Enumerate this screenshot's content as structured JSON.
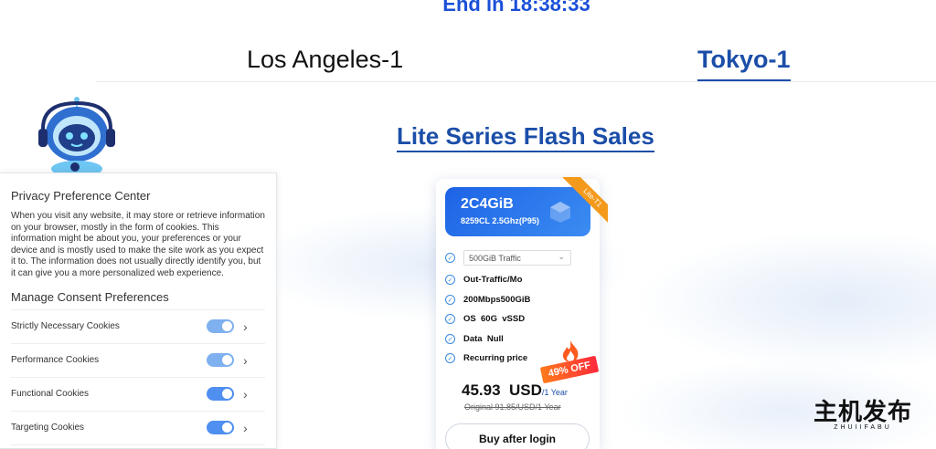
{
  "countdown": {
    "text": "End in 18:38:33"
  },
  "tabs": [
    {
      "label": "Los Angeles-1",
      "active": false
    },
    {
      "label": "Tokyo-1",
      "active": true
    }
  ],
  "section": {
    "title": "Lite Series Flash Sales"
  },
  "privacy": {
    "title": "Privacy Preference Center",
    "body": "When you visit any website, it may store or retrieve information on your browser, mostly in the form of cookies. This information might be about you, your preferences or your device and is mostly used to make the site work as you expect it to. The information does not usually directly identify you, but it can give you a more personalized web experience.",
    "manage_title": "Manage Consent Preferences",
    "items": [
      {
        "label": "Strictly Necessary Cookies"
      },
      {
        "label": "Performance Cookies"
      },
      {
        "label": "Functional Cookies"
      },
      {
        "label": "Targeting Cookies"
      }
    ]
  },
  "card": {
    "plan": "2C4GiB",
    "cpu": "8259CL 2.5Ghz(P95)",
    "ribbon": "Lite-T1",
    "traffic_select": "500GiB Traffic",
    "features": [
      "Out-Traffic/Mo",
      "200Mbps500GiB",
      "OS  60G  vSSD",
      "Data  Null",
      "Recurring price"
    ],
    "price": "45.93  USD",
    "period": "/1 Year",
    "original": "Original 91.85/USD/1 Year",
    "discount": "49% OFF",
    "buy_label": "Buy after login"
  },
  "watermark": {
    "cn": "主机发布",
    "en": "ZHUIIFABU"
  },
  "colors": {
    "accent": "#1b4ea8",
    "toggle": "#4e8ff0",
    "discount": "#ff3a2a"
  }
}
